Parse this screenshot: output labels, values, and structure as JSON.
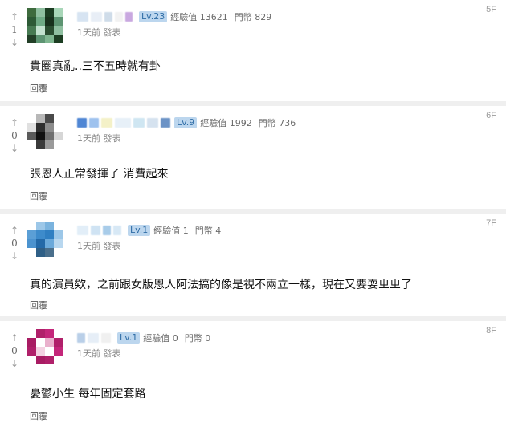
{
  "comments": [
    {
      "floor": "5F",
      "up": "↑",
      "score": "1",
      "down": "↓",
      "level": "Lv.23",
      "exp": "經驗值 13621",
      "coins": "門幣 829",
      "time": "1天前",
      "posted": "發表",
      "text": "貴圈真亂..三不五時就有卦",
      "reply": "回覆",
      "avatar_colors": [
        "#3e6b3e",
        "#8fbfa0",
        "#1c3d22",
        "#a8d6b8",
        "#2d5a36",
        "#6faa85",
        "#18301c",
        "#5d9472",
        "#477a52",
        "#c3e2cf",
        "#2a4d30",
        "#8fbfa0",
        "#223f27",
        "#5d9472",
        "#7fb690",
        "#1c3d22"
      ]
    },
    {
      "floor": "6F",
      "up": "↑",
      "score": "0",
      "down": "↓",
      "level": "Lv.9",
      "exp": "經驗值 1992",
      "coins": "門幣 736",
      "time": "1天前",
      "posted": "發表",
      "text": "張恩人正常發揮了 消費起來",
      "reply": "回覆",
      "avatar_colors": [
        "#ffffff",
        "#b8b8b8",
        "#4a4a4a",
        "#ffffff",
        "#e0e0e0",
        "#2e2e2e",
        "#8c8c8c",
        "#ffffff",
        "#5a5a5a",
        "#111111",
        "#6e6e6e",
        "#d6d6d6",
        "#ffffff",
        "#3a3a3a",
        "#9a9a9a",
        "#ffffff"
      ]
    },
    {
      "floor": "7F",
      "up": "↑",
      "score": "0",
      "down": "↓",
      "level": "Lv.1",
      "exp": "經驗值 1",
      "coins": "門幣 4",
      "time": "1天前",
      "posted": "發表",
      "text": "真的演員欸，之前跟女版恩人阿法搞的像是視不兩立一樣，現在又要耍ㄓㄓ了",
      "reply": "回覆",
      "avatar_colors": [
        "#ffffff",
        "#9cc7e8",
        "#7ab3de",
        "#ffffff",
        "#5b9fd6",
        "#3d8bcb",
        "#2f7fc2",
        "#9cc7e8",
        "#4c93cf",
        "#2369a8",
        "#6aa9db",
        "#b8d7ef",
        "#ffffff",
        "#2f5f86",
        "#4a6f8c",
        "#ffffff"
      ]
    },
    {
      "floor": "8F",
      "up": "↑",
      "score": "0",
      "down": "↓",
      "level": "Lv.1",
      "exp": "經驗值 0",
      "coins": "門幣 0",
      "time": "1天前",
      "posted": "發表",
      "text": "憂鬱小生 每年固定套路",
      "reply": "回覆",
      "avatar_colors": [
        "#ffffff",
        "#b0206a",
        "#c4267a",
        "#ffffff",
        "#a81c63",
        "#ffffff",
        "#e9b0cc",
        "#b0206a",
        "#b0206a",
        "#f3d2e2",
        "#ffffff",
        "#c4267a",
        "#ffffff",
        "#a81c63",
        "#b0206a",
        "#ffffff"
      ]
    }
  ]
}
